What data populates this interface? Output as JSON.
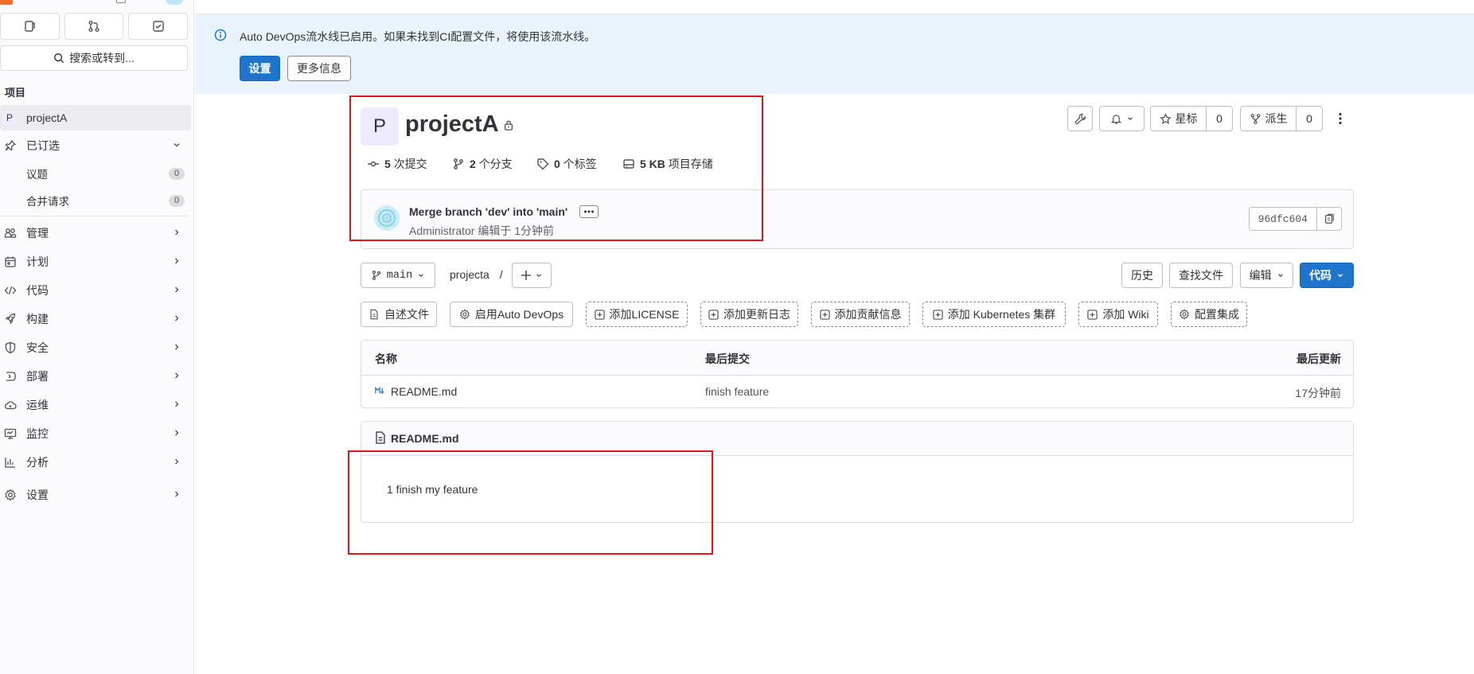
{
  "sidebar": {
    "search_label": "搜索或转到...",
    "section_label": "项目",
    "project": {
      "avatar_letter": "P",
      "name": "projectA"
    },
    "pinned": {
      "label": "已订选",
      "items": [
        {
          "label": "议题",
          "count": "0"
        },
        {
          "label": "合并请求",
          "count": "0"
        }
      ]
    },
    "nav": [
      {
        "label": "管理",
        "icon": "users-icon"
      },
      {
        "label": "计划",
        "icon": "calendar-icon"
      },
      {
        "label": "代码",
        "icon": "code-icon"
      },
      {
        "label": "构建",
        "icon": "rocket-icon"
      },
      {
        "label": "安全",
        "icon": "shield-icon"
      },
      {
        "label": "部署",
        "icon": "deploy-icon"
      },
      {
        "label": "运维",
        "icon": "cloud-icon"
      },
      {
        "label": "监控",
        "icon": "monitor-icon"
      },
      {
        "label": "分析",
        "icon": "chart-icon"
      },
      {
        "label": "设置",
        "icon": "gear-icon"
      }
    ]
  },
  "alert": {
    "text": "Auto DevOps流水线已启用。如果未找到CI配置文件，将使用该流水线。",
    "primary_button": "设置",
    "secondary_button": "更多信息"
  },
  "project": {
    "avatar_letter": "P",
    "title": "projectA",
    "stats": {
      "commits": {
        "count": "5",
        "label": "次提交"
      },
      "branches": {
        "count": "2",
        "label": "个分支"
      },
      "tags": {
        "count": "0",
        "label": "个标签"
      },
      "storage": {
        "count": "5 KB",
        "label": "项目存储"
      }
    },
    "actions": {
      "star_label": "星标",
      "star_count": "0",
      "fork_label": "派生",
      "fork_count": "0"
    }
  },
  "last_commit": {
    "title": "Merge branch 'dev' into 'main'",
    "author": "Administrator",
    "meta": "编辑于 1分钟前",
    "sha": "96dfc604"
  },
  "toolbar": {
    "branch": "main",
    "path": "projecta",
    "path_sep": "/",
    "history": "历史",
    "find_file": "查找文件",
    "edit": "编辑",
    "code": "代码"
  },
  "quick_actions": [
    "自述文件",
    "启用Auto DevOps",
    "添加LICENSE",
    "添加更新日志",
    "添加贡献信息",
    "添加 Kubernetes 集群",
    "添加 Wiki",
    "配置集成"
  ],
  "file_table": {
    "headers": {
      "name": "名称",
      "last_commit": "最后提交",
      "last_update": "最后更新"
    },
    "rows": [
      {
        "name": "README.md",
        "last_commit": "finish feature",
        "last_update": "17分钟前"
      }
    ]
  },
  "readme": {
    "filename": "README.md",
    "content": "1 finish my feature"
  },
  "colors": {
    "primary": "#1f75cb",
    "alert_bg": "#e9f3fc",
    "annotation": "#e8121b",
    "avatar_bg": "#eeeaff"
  }
}
